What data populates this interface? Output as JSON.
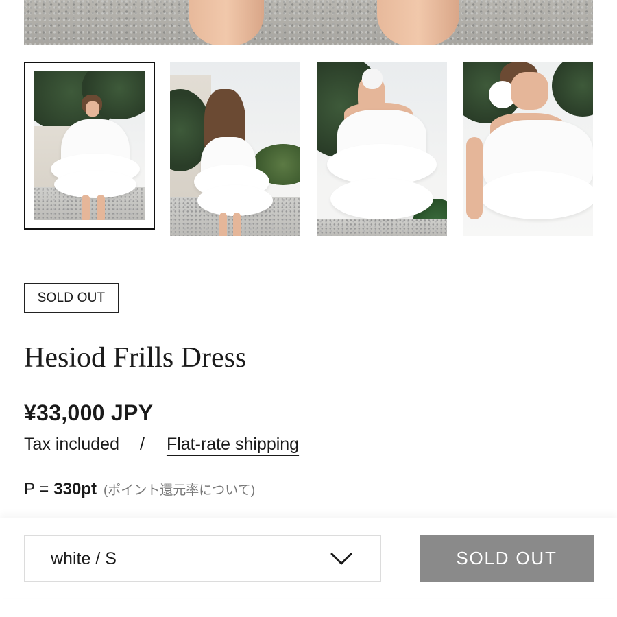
{
  "product": {
    "badge": "SOLD OUT",
    "title": "Hesiod Frills Dress",
    "price": "¥33,000 JPY",
    "tax_label": "Tax included",
    "separator": "/",
    "shipping_link": "Flat-rate shipping",
    "points_prefix": "P =",
    "points_value": "330pt",
    "points_note": "(ポイント還元率について)"
  },
  "gallery": {
    "thumbnail_count": 4,
    "selected_index": 0
  },
  "purchase_bar": {
    "variant_value": "white / S",
    "button_label": "SOLD OUT"
  },
  "colors": {
    "button_disabled": "#8a8a8a",
    "text": "#1a1a1a",
    "muted": "#777777"
  }
}
